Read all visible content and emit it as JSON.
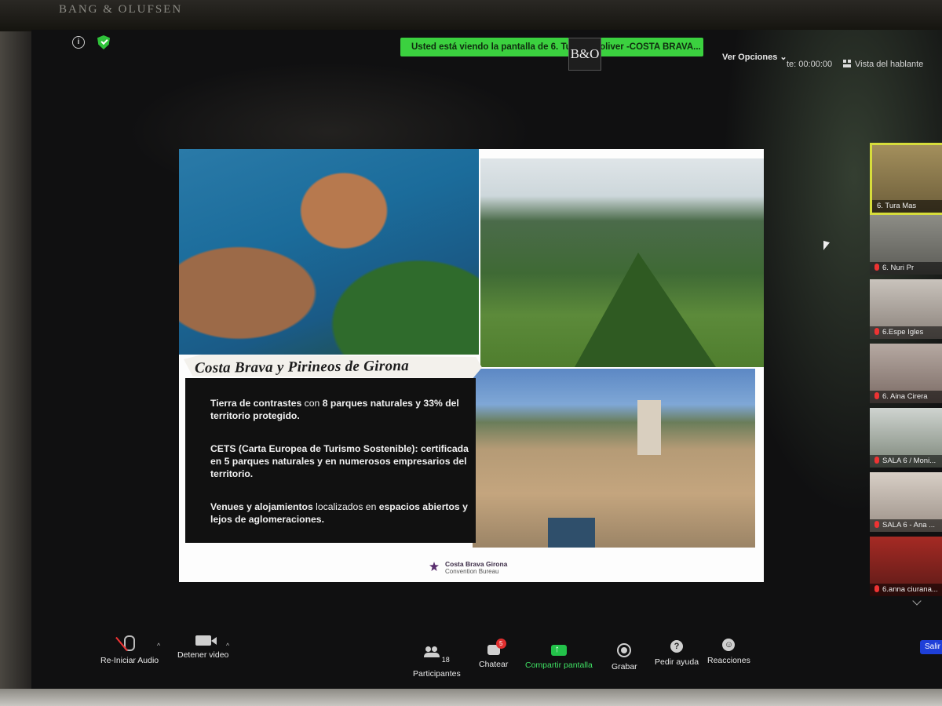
{
  "device": {
    "brand": "BANG & OLUFSEN"
  },
  "topbar": {
    "banner_text": "Usted está viendo la pantalla de 6. Tura Masoliver -COSTA BRAVA...",
    "logo_text": "B&O",
    "view_options": "Ver Opciones ⌄",
    "timer": "te: 00:00:00",
    "speaker_view": "Vista del hablante"
  },
  "slide": {
    "title": "Costa Brava y Pirineos de Girona",
    "paragraphs": [
      {
        "bold": "Tierra de contrastes",
        "normal": " con ",
        "bold2": "8 parques naturales y 33% del territorio protegido."
      },
      {
        "bold": "CETS (Carta Europea de Turismo Sostenible): certificada en 5 parques naturales y en numerosos empresarios del territorio.",
        "normal": "",
        "bold2": ""
      },
      {
        "bold": "Venues y alojamientos",
        "normal": " localizados en ",
        "bold2": "espacios abiertos y lejos de aglomeraciones."
      }
    ],
    "footer_name": "Costa Brava Girona",
    "footer_sub": "Convention Bureau"
  },
  "participants": [
    "6. Tura Mas",
    "6. Nuri Pr",
    "6.Espe Igles",
    "6. Aina Cirera",
    "SALA 6 / Moni...",
    "SALA 6 - Ana ...",
    "6.anna ciurana..."
  ],
  "toolbar": {
    "audio": "Re-Iniciar Audio",
    "video": "Detener video",
    "participants": "Participantes",
    "participants_count": "18",
    "chat": "Chatear",
    "chat_badge": "5",
    "share": "Compartir pantalla",
    "record": "Grabar",
    "help": "Pedir ayuda",
    "reactions": "Reacciones",
    "exit": "Salir"
  },
  "colors": {
    "banner": "#3bd13f",
    "active_speaker_border": "#d7dd3b",
    "share_button": "#23c24a",
    "exit_button": "#1e3fd8",
    "badge": "#e02e2e"
  }
}
